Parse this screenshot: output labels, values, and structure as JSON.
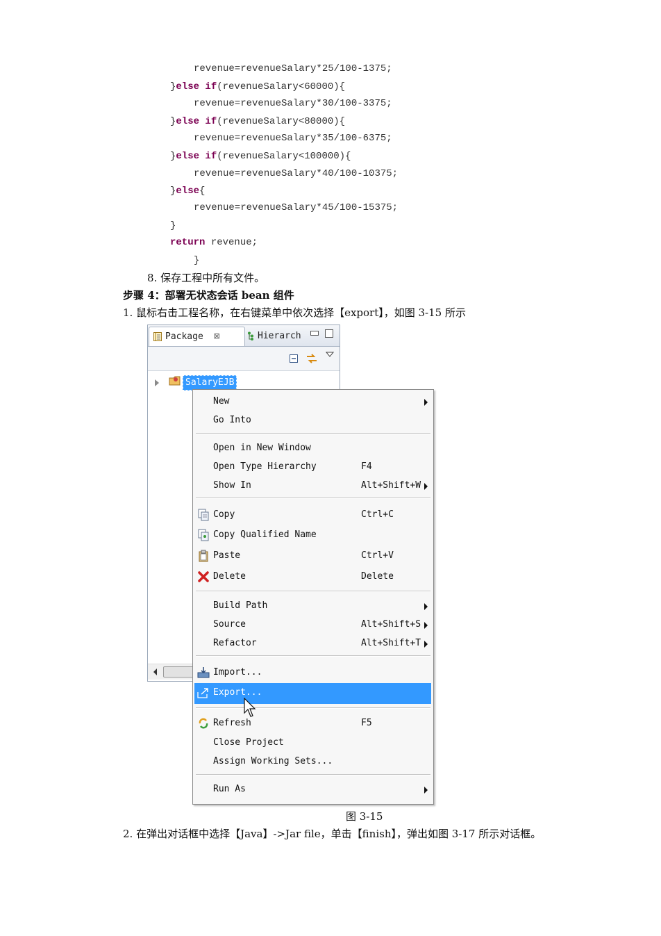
{
  "code": {
    "l1": "revenue=revenueSalary*25/100-1375;",
    "l2_a": "}",
    "l2_kw": "else if",
    "l2_b": "(revenueSalary<60000){",
    "l3": "revenue=revenueSalary*30/100-3375;",
    "l4_a": "}",
    "l4_kw": "else if",
    "l4_b": "(revenueSalary<80000){",
    "l5": "revenue=revenueSalary*35/100-6375;",
    "l6_a": "}",
    "l6_kw": "else if",
    "l6_b": "(revenueSalary<100000){",
    "l7": "revenue=revenueSalary*40/100-10375;",
    "l8_a": "}",
    "l8_kw": "else",
    "l8_b": "{",
    "l9": "revenue=revenueSalary*45/100-15375;",
    "l10": "}",
    "l11_kw": "return",
    "l11_b": " revenue;",
    "l12": "}"
  },
  "text": {
    "step8": "8. 保存工程中所有文件。",
    "heading": "步骤 4：部署无状态会话 bean 组件",
    "step1": "1. 鼠标右击工程名称，在右键菜单中依次选择【export】，如图 3-15 所示",
    "caption": "图 3-15",
    "step2": "2. 在弹出对话框中选择【Java】->Jar file，单击【finish】，弹出如图 3-17 所示对话框。"
  },
  "panel": {
    "tab_package": "Package",
    "tab_close": "⊠",
    "tab_hierarchy": "Hierarch",
    "project": "SalaryEJB"
  },
  "menu": {
    "items": [
      {
        "label": "New",
        "shortcut": ""
      },
      {
        "label": "Go Into",
        "shortcut": ""
      },
      {
        "label": "Open in New Window",
        "shortcut": ""
      },
      {
        "label": "Open Type Hierarchy",
        "shortcut": "F4"
      },
      {
        "label": "Show In",
        "shortcut": "Alt+Shift+W"
      },
      {
        "label": "Copy",
        "shortcut": "Ctrl+C"
      },
      {
        "label": "Copy Qualified Name",
        "shortcut": ""
      },
      {
        "label": "Paste",
        "shortcut": "Ctrl+V"
      },
      {
        "label": "Delete",
        "shortcut": "Delete"
      },
      {
        "label": "Build Path",
        "shortcut": ""
      },
      {
        "label": "Source",
        "shortcut": "Alt+Shift+S"
      },
      {
        "label": "Refactor",
        "shortcut": "Alt+Shift+T"
      },
      {
        "label": "Import...",
        "shortcut": ""
      },
      {
        "label": "Export...",
        "shortcut": ""
      },
      {
        "label": "Refresh",
        "shortcut": "F5"
      },
      {
        "label": "Close Project",
        "shortcut": ""
      },
      {
        "label": "Assign Working Sets...",
        "shortcut": ""
      },
      {
        "label": "Run As",
        "shortcut": ""
      }
    ]
  },
  "colors": {
    "keyword": "#7b0052",
    "highlight": "#3399ff"
  }
}
